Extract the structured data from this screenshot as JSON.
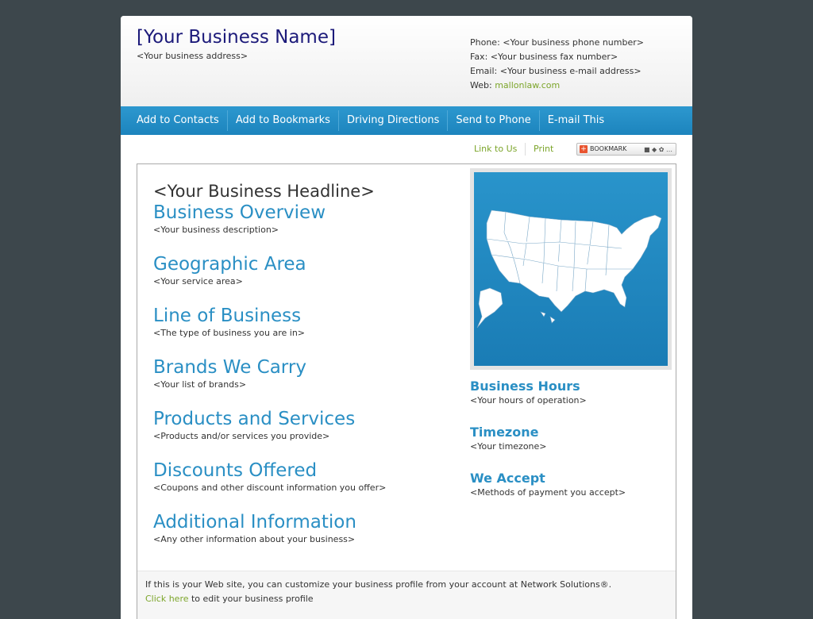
{
  "header": {
    "business_name": "[Your Business Name]",
    "business_address": "<Your business address>",
    "phone": "Phone: <Your business phone number>",
    "fax": "Fax: <Your business fax number>",
    "email": "Email: <Your business e-mail address>",
    "web_label": "Web: ",
    "web_link": "mallonlaw.com"
  },
  "nav": {
    "items": [
      "Add to Contacts",
      "Add to Bookmarks",
      "Driving Directions",
      "Send to Phone",
      "E-mail This"
    ]
  },
  "toolbar": {
    "link_to_us": "Link to Us",
    "print": "Print",
    "bookmark": "BOOKMARK",
    "bookmark_plus": "+"
  },
  "main": {
    "headline": "<Your Business Headline>",
    "sections": [
      {
        "title": "Business Overview",
        "desc": "<Your business description>"
      },
      {
        "title": "Geographic Area",
        "desc": "<Your service area>"
      },
      {
        "title": "Line of Business",
        "desc": "<The type of business you are in>"
      },
      {
        "title": "Brands We Carry",
        "desc": "<Your list of brands>"
      },
      {
        "title": "Products and Services",
        "desc": "<Products and/or services you provide>"
      },
      {
        "title": "Discounts Offered",
        "desc": "<Coupons and other discount information you offer>"
      },
      {
        "title": "Additional Information",
        "desc": "<Any other information about your business>"
      }
    ]
  },
  "sidebar": {
    "sections": [
      {
        "title": "Business Hours",
        "desc": "<Your hours of operation>"
      },
      {
        "title": "Timezone",
        "desc": "<Your timezone>"
      },
      {
        "title": "We Accept",
        "desc": "<Methods of payment you accept>"
      }
    ]
  },
  "footer": {
    "note": "If this is your Web site, you can customize your business profile from your account at Network Solutions®.",
    "click_here": "Click here",
    "edit_text": " to edit your business profile"
  },
  "colors": {
    "brand_blue": "#2a8fc4",
    "nav_blue": "#1c84bd",
    "link_green": "#7ca52a",
    "title_navy": "#1c1a7a",
    "background": "#3d474c"
  }
}
